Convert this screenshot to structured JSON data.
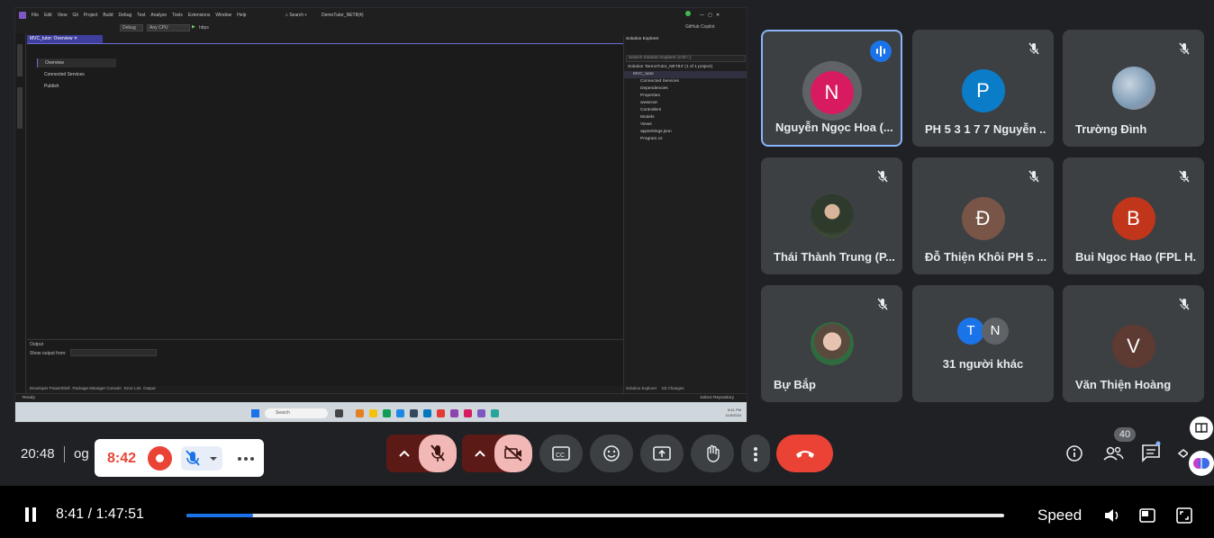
{
  "shared_screen": {
    "menu": [
      "File",
      "Edit",
      "View",
      "Git",
      "Project",
      "Build",
      "Debug",
      "Test",
      "Analyze",
      "Tools",
      "Extensions",
      "Window",
      "Help"
    ],
    "search_label": "Search",
    "solution_title": "DemoTutor_NET8(4)",
    "github_copilot": "GitHub Copilot",
    "config": "Debug",
    "platform": "Any CPU",
    "run_target": "https",
    "doc_tab": "MVC_tutor: Overview",
    "overview_items": [
      "Overview",
      "Connected Services",
      "Publish"
    ],
    "output_title": "Output",
    "output_show_from": "Show output from:",
    "bottom_tabs": [
      "Developer PowerShell",
      "Package Manager Console",
      "Error List",
      "Output"
    ],
    "solution_explorer": {
      "title": "Solution Explorer",
      "search_placeholder": "Search Solution Explorer (Ctrl+;)",
      "solution_line": "Solution 'DemoTutor_NET84' (1 of 1 project)",
      "tree": [
        "MVC_tutor",
        "Connected Services",
        "Dependencies",
        "Properties",
        "wwwroot",
        "Controllers",
        "Models",
        "Views",
        "appsettings.json",
        "Program.cs"
      ],
      "footer_tabs": [
        "Solution Explorer",
        "Git Changes"
      ]
    },
    "status_ready": "Ready",
    "status_right": "Select Repository",
    "taskbar_search": "Search",
    "taskbar_time": "8:41 PM",
    "taskbar_date": "11/5/2024"
  },
  "participants": [
    {
      "name": "Nguyễn Ngọc Hoa (...",
      "initial": "N",
      "color": "#d81b60",
      "speaking": true
    },
    {
      "name": "PH 5 3 1 7 7 Nguyễn ...",
      "initial": "P",
      "color": "#0b7cc7",
      "speaking": false
    },
    {
      "name": "Trường Đình",
      "initial": "",
      "color": "#6d8fa8",
      "speaking": false
    },
    {
      "name": "Thái Thành Trung (P...",
      "initial": "",
      "color": "#3d4a3a",
      "speaking": false
    },
    {
      "name": "Đỗ Thiện Khôi PH 5 ...",
      "initial": "Đ",
      "color": "#795548",
      "speaking": false
    },
    {
      "name": "Bui Ngoc Hao (FPL H...",
      "initial": "B",
      "color": "#c1361a",
      "speaking": false
    },
    {
      "name": "Bự Bắp",
      "initial": "",
      "color": "#7b6a5a",
      "speaking": false
    },
    {
      "name": "31 người khác",
      "initial": "",
      "color": "#3c4043",
      "speaking": false
    },
    {
      "name": "Văn Thiện Hoàng",
      "initial": "V",
      "color": "#5d3a32",
      "speaking": false
    }
  ],
  "others_avatars": [
    {
      "initial": "T",
      "color": "#1a73e8"
    },
    {
      "initial": "N",
      "color": "#5f6368"
    }
  ],
  "meeting": {
    "clock": "20:48",
    "code": "og",
    "recording_time": "8:42",
    "people_count": "40"
  },
  "player": {
    "time": "8:41 / 1:47:51",
    "progress": 0.081,
    "speed_label": "Speed"
  },
  "colors": {
    "accent": "#1a73e8",
    "end_call": "#ea4335",
    "tile_bg": "#3c4043"
  }
}
